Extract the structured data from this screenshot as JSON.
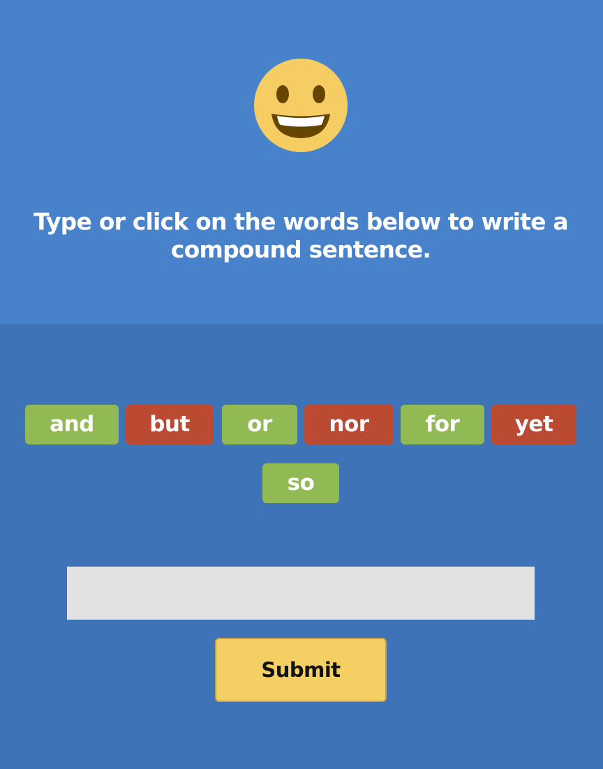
{
  "header": {
    "emoji_icon": "grinning-face-icon",
    "instruction": "Type or click on the words below to write a compound sentence."
  },
  "word_bank": [
    {
      "label": "and",
      "color": "#92ba54"
    },
    {
      "label": "but",
      "color": "#bb4a33"
    },
    {
      "label": "or",
      "color": "#92ba54"
    },
    {
      "label": "nor",
      "color": "#bb4a33"
    },
    {
      "label": "for",
      "color": "#92ba54"
    },
    {
      "label": "yet",
      "color": "#bb4a33"
    },
    {
      "label": "so",
      "color": "#92ba54"
    }
  ],
  "answer": {
    "value": "",
    "placeholder": ""
  },
  "submit_label": "Submit",
  "colors": {
    "top_background": "#4882cb",
    "bottom_background": "#3e74b7",
    "input_background": "#e2e2e2",
    "submit_background": "#f4cf63"
  }
}
